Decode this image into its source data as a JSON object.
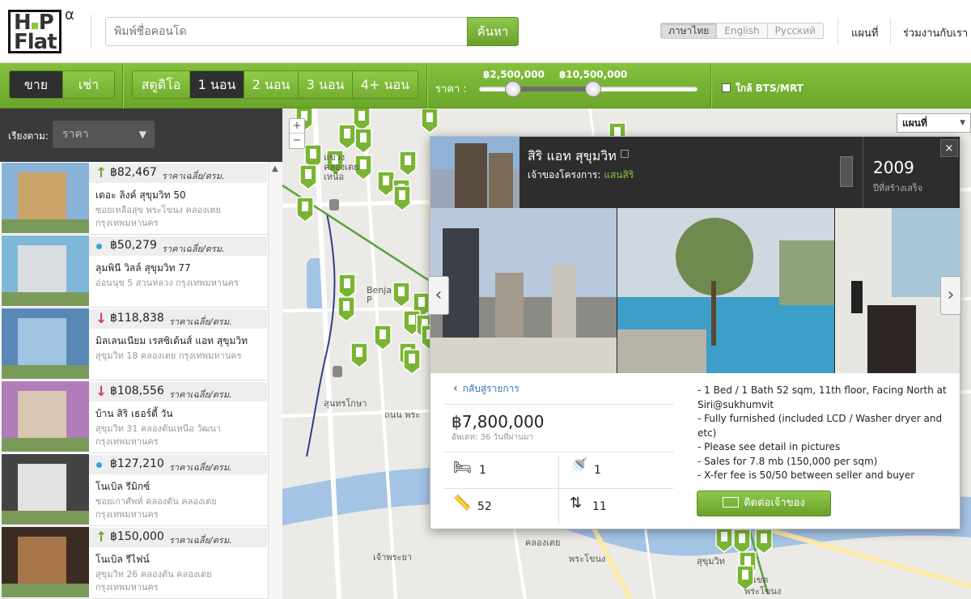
{
  "header": {
    "logo_text": "HipFlat",
    "logo_badge": "α",
    "search_placeholder": "พิมพ์ชื่อคอนโด",
    "search_button": "ค้นหา",
    "languages": [
      "ภาษาไทย",
      "English",
      "Русский"
    ],
    "nav": [
      "แผนที่",
      "ร่วมงานกับเรา"
    ]
  },
  "filters": {
    "mode": [
      "ขาย",
      "เช่า"
    ],
    "rooms": [
      "สตูดิโอ",
      "1 นอน",
      "2 นอน",
      "3 นอน",
      "4+ นอน"
    ],
    "price_label": "ราคา :",
    "price_min": "฿2,500,000",
    "price_max": "฿10,500,000",
    "bts_label": "ใกล้ BTS/MRT"
  },
  "sidebar": {
    "sort_label": "เรียงตาม:",
    "sort_value": "ราคา",
    "listings": [
      {
        "trend": "up",
        "price": "฿82,467",
        "unit": "ราคาเฉลี่ย/ตรม.",
        "name": "เดอะ ลิงค์ สุขุมวิท 50",
        "address": "ซอยเหลือสุข พระโขนง คลองเตย กรุงเทพมหานคร"
      },
      {
        "trend": "none",
        "price": "฿50,279",
        "unit": "ราคาเฉลี่ย/ตรม.",
        "name": "ลุมพินี วิลล์ สุขุมวิท 77",
        "address": "อ่อนนุช 5 สวนหลวง กรุงเทพมหานคร"
      },
      {
        "trend": "down",
        "price": "฿118,838",
        "unit": "ราคาเฉลี่ย/ตรม.",
        "name": "มิลเลนเนียม เรสซิเด้นส์ แอท สุขุมวิท",
        "address": "สุขุมวิท 18 คลองเตย กรุงเทพมหานคร"
      },
      {
        "trend": "down",
        "price": "฿108,556",
        "unit": "ราคาเฉลี่ย/ตรม.",
        "name": "บ้าน สิริ เธอร์ตี้ วัน",
        "address": "สุขุมวิท 31 คลองตันเหนือ วัฒนา กรุงเทพมหานคร"
      },
      {
        "trend": "none",
        "price": "฿127,210",
        "unit": "ราคาเฉลี่ย/ตรม.",
        "name": "โนเบิล รีมิกซ์",
        "address": "ซอยเกาศัพท์ คลองตัน คลองเตย กรุงเทพมหานคร"
      },
      {
        "trend": "up",
        "price": "฿150,000",
        "unit": "ราคาเฉลี่ย/ตรม.",
        "name": "โนเบิล รีไฟน์",
        "address": "สุขุมวิท 26 คลองตัน คลองเตย กรุงเทพมหานคร"
      }
    ]
  },
  "map": {
    "type_select": "แผนที่",
    "labels": [
      "แขวง",
      "คลองเตย",
      "เหนือ",
      "Benja",
      "P",
      "สุนทรโกษา",
      "ถนน พระ",
      "เจ้าพระยา",
      "พระโขนง",
      "คลองเตย",
      "สุขุมวิท",
      "เขต",
      "พระโขนง"
    ],
    "accent": "#7ab434"
  },
  "detail": {
    "title": "สิริ แอท สุขุมวิท",
    "developer_label": "เจ้าของโครงการ:",
    "developer": "แสนสิริ",
    "year": "2009",
    "year_label": "ปีที่สร้างเสร็จ",
    "close": "×",
    "back": "กลับสู่รายการ",
    "price": "฿7,800,000",
    "updated": "อัพเดท: 36 วันที่ผ่านมา",
    "bed": "1",
    "bath": "1",
    "area": "52",
    "floor": "11",
    "description": [
      "- 1 Bed / 1 Bath 52 sqm, 11th floor, Facing North at Siri@sukhumvit",
      "- Fully furnished (included LCD / Washer dryer and etc)",
      "- Please see detail in pictures",
      "- Sales for 7.8 mb (150,000 per sqm)",
      "- X-fer fee is 50/50 between seller and buyer"
    ],
    "contact": "ติดต่อเจ้าของ"
  }
}
